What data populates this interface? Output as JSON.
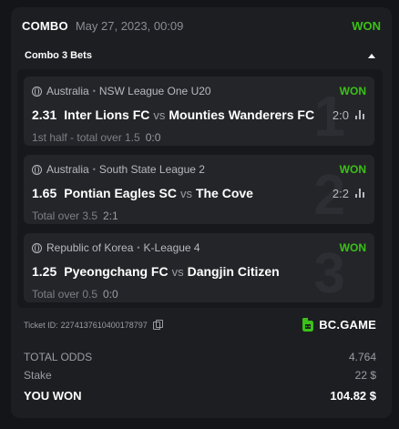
{
  "header": {
    "bet_type": "COMBO",
    "date": "May 27, 2023, 00:09",
    "status": "WON"
  },
  "combo": {
    "label": "Combo 3 Bets"
  },
  "legs": [
    {
      "number": "1",
      "country": "Australia",
      "league": "NSW League One U20",
      "status": "WON",
      "odds": "2.31",
      "home": "Inter Lions FC",
      "vs": "vs",
      "away": "Mounties Wanderers FC",
      "score": "2:0",
      "market": "1st half - total over 1.5",
      "market_result": "0:0"
    },
    {
      "number": "2",
      "country": "Australia",
      "league": "South State League 2",
      "status": "WON",
      "odds": "1.65",
      "home": "Pontian Eagles SC",
      "vs": "vs",
      "away": "The Cove",
      "score": "2:2",
      "market": "Total over 3.5",
      "market_result": "2:1"
    },
    {
      "number": "3",
      "country": "Republic of Korea",
      "league": "K-League 4",
      "status": "WON",
      "odds": "1.25",
      "home": "Pyeongchang FC",
      "vs": "vs",
      "away": "Dangjin Citizen",
      "score": "",
      "market": "Total over 0.5",
      "market_result": "0:0"
    }
  ],
  "ticket": {
    "label": "Ticket ID:",
    "id": "2274137610400178797"
  },
  "brand": {
    "name": "BC.GAME",
    "color": "#3bc117"
  },
  "totals": {
    "total_odds_label": "TOTAL ODDS",
    "total_odds_value": "4.764",
    "stake_label": "Stake",
    "stake_value": "22 $",
    "won_label": "YOU WON",
    "won_value": "104.82 $"
  },
  "colors": {
    "background": "#141518",
    "card": "#1d1e22",
    "leg": "#242529",
    "won": "#3bc117"
  }
}
